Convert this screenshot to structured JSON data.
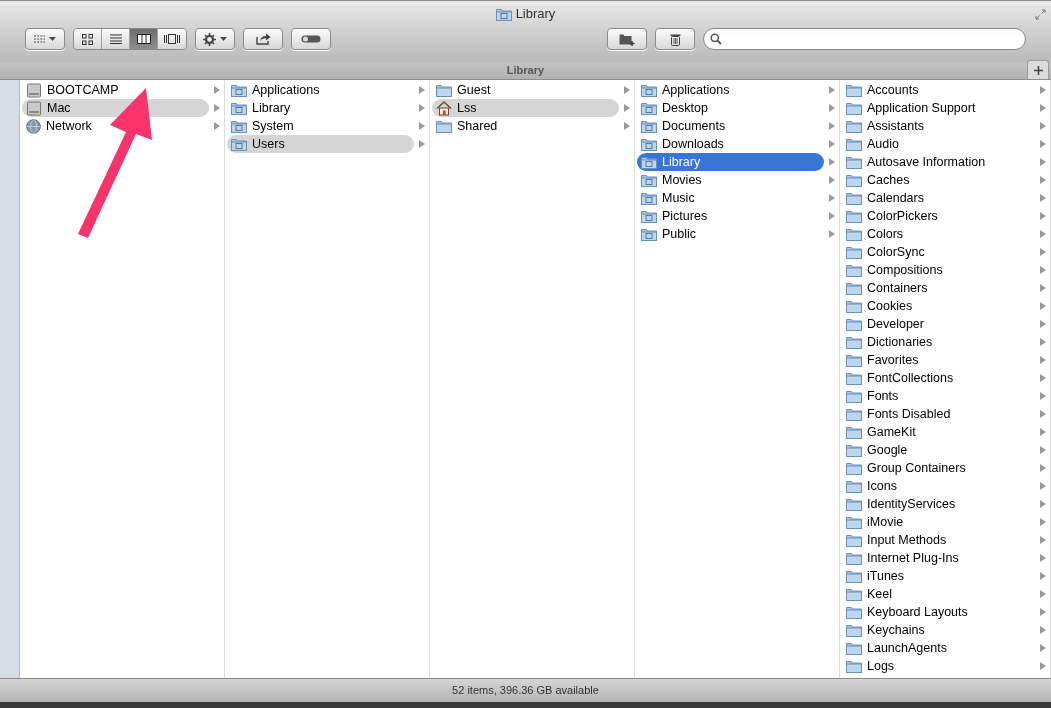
{
  "window": {
    "title": "Library"
  },
  "toolbar": {
    "view_modes": [
      {
        "kind": "icons",
        "selected": false
      },
      {
        "kind": "list",
        "selected": false
      },
      {
        "kind": "columns",
        "selected": true
      },
      {
        "kind": "coverflow",
        "selected": false
      }
    ]
  },
  "path_bar": {
    "title": "Library"
  },
  "columns": [
    {
      "items": [
        {
          "name": "BOOTCAMP",
          "kind": "drive",
          "selected": false
        },
        {
          "name": "Mac",
          "kind": "drive",
          "selected": true,
          "focused": false
        },
        {
          "name": "Network",
          "kind": "network",
          "selected": false
        }
      ]
    },
    {
      "items": [
        {
          "name": "Applications",
          "kind": "badged",
          "selected": false
        },
        {
          "name": "Library",
          "kind": "badged",
          "selected": false
        },
        {
          "name": "System",
          "kind": "badged",
          "selected": false
        },
        {
          "name": "Users",
          "kind": "badged",
          "selected": true,
          "focused": false
        }
      ]
    },
    {
      "items": [
        {
          "name": "Guest",
          "kind": "folder",
          "selected": false
        },
        {
          "name": "Lss",
          "kind": "home",
          "selected": true,
          "focused": false
        },
        {
          "name": "Shared",
          "kind": "folder",
          "selected": false
        }
      ]
    },
    {
      "items": [
        {
          "name": "Applications",
          "kind": "badged",
          "selected": false
        },
        {
          "name": "Desktop",
          "kind": "badged",
          "selected": false
        },
        {
          "name": "Documents",
          "kind": "badged",
          "selected": false
        },
        {
          "name": "Downloads",
          "kind": "badged",
          "selected": false
        },
        {
          "name": "Library",
          "kind": "badged",
          "selected": true,
          "focused": true
        },
        {
          "name": "Movies",
          "kind": "badged",
          "selected": false
        },
        {
          "name": "Music",
          "kind": "badged",
          "selected": false
        },
        {
          "name": "Pictures",
          "kind": "badged",
          "selected": false
        },
        {
          "name": "Public",
          "kind": "badged",
          "selected": false
        }
      ]
    },
    {
      "items": [
        {
          "name": "Accounts",
          "kind": "folder",
          "selected": false
        },
        {
          "name": "Application Support",
          "kind": "folder",
          "selected": false
        },
        {
          "name": "Assistants",
          "kind": "folder",
          "selected": false
        },
        {
          "name": "Audio",
          "kind": "folder",
          "selected": false
        },
        {
          "name": "Autosave Information",
          "kind": "folder",
          "selected": false
        },
        {
          "name": "Caches",
          "kind": "folder",
          "selected": false
        },
        {
          "name": "Calendars",
          "kind": "folder",
          "selected": false
        },
        {
          "name": "ColorPickers",
          "kind": "folder",
          "selected": false
        },
        {
          "name": "Colors",
          "kind": "folder",
          "selected": false
        },
        {
          "name": "ColorSync",
          "kind": "folder",
          "selected": false
        },
        {
          "name": "Compositions",
          "kind": "folder",
          "selected": false
        },
        {
          "name": "Containers",
          "kind": "folder",
          "selected": false
        },
        {
          "name": "Cookies",
          "kind": "folder",
          "selected": false
        },
        {
          "name": "Developer",
          "kind": "folder",
          "selected": false
        },
        {
          "name": "Dictionaries",
          "kind": "folder",
          "selected": false
        },
        {
          "name": "Favorites",
          "kind": "folder",
          "selected": false
        },
        {
          "name": "FontCollections",
          "kind": "folder",
          "selected": false
        },
        {
          "name": "Fonts",
          "kind": "folder",
          "selected": false
        },
        {
          "name": "Fonts Disabled",
          "kind": "folder",
          "selected": false
        },
        {
          "name": "GameKit",
          "kind": "folder",
          "selected": false
        },
        {
          "name": "Google",
          "kind": "folder",
          "selected": false
        },
        {
          "name": "Group Containers",
          "kind": "folder",
          "selected": false
        },
        {
          "name": "Icons",
          "kind": "folder",
          "selected": false
        },
        {
          "name": "IdentityServices",
          "kind": "folder",
          "selected": false
        },
        {
          "name": "iMovie",
          "kind": "folder",
          "selected": false
        },
        {
          "name": "Input Methods",
          "kind": "folder",
          "selected": false
        },
        {
          "name": "Internet Plug-Ins",
          "kind": "folder",
          "selected": false
        },
        {
          "name": "iTunes",
          "kind": "folder",
          "selected": false
        },
        {
          "name": "Keel",
          "kind": "folder",
          "selected": false
        },
        {
          "name": "Keyboard Layouts",
          "kind": "folder",
          "selected": false
        },
        {
          "name": "Keychains",
          "kind": "folder",
          "selected": false
        },
        {
          "name": "LaunchAgents",
          "kind": "folder",
          "selected": false
        },
        {
          "name": "Logs",
          "kind": "folder",
          "selected": false
        }
      ]
    }
  ],
  "status_bar": "52 items, 396.36 GB available",
  "annotation": {
    "kind": "arrow"
  }
}
